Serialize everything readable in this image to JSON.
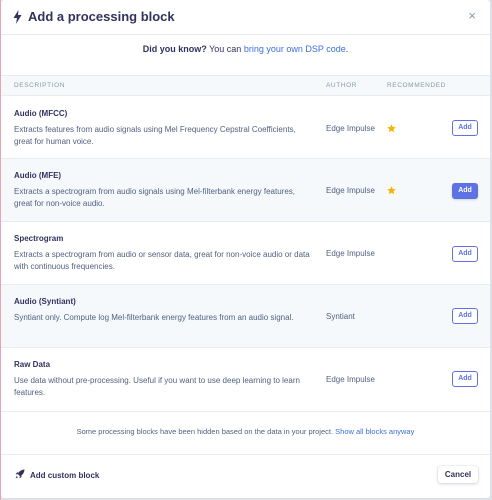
{
  "header": {
    "title": "Add a processing block",
    "close_glyph": "×",
    "icons": [
      "bolt-icon",
      "close-icon"
    ]
  },
  "tip": {
    "lead": "Did you know?",
    "text": " You can ",
    "link": "bring your own DSP code",
    "trail": "."
  },
  "table": {
    "columns": [
      "DESCRIPTION",
      "AUTHOR",
      "RECOMMENDED"
    ],
    "rows": [
      {
        "name": "Audio (MFCC)",
        "description": "Extracts features from audio signals using Mel Frequency Cepstral Coefficients, great for human voice.",
        "author": "Edge Impulse",
        "recommended": true,
        "button": "Add"
      },
      {
        "name": "Audio (MFE)",
        "description": "Extracts a spectrogram from audio signals using Mel-filterbank energy features, great for non-voice audio.",
        "author": "Edge Impulse",
        "recommended": true,
        "button": "Add"
      },
      {
        "name": "Spectrogram",
        "description": "Extracts a spectrogram from audio or sensor data, great for non-voice audio or data with continuous frequencies.",
        "author": "Edge Impulse",
        "recommended": false,
        "button": "Add"
      },
      {
        "name": "Audio (Syntiant)",
        "description": "Syntiant only. Compute log Mel-filterbank energy features from an audio signal.",
        "author": "Syntiant",
        "recommended": false,
        "button": "Add"
      },
      {
        "name": "Raw Data",
        "description": "Use data without pre-processing. Useful if you want to use deep learning to learn features.",
        "author": "Edge Impulse",
        "recommended": false,
        "button": "Add"
      }
    ]
  },
  "hidden_note": {
    "text": "Some processing blocks have been hidden based on the data in your project. ",
    "link": "Show all blocks anyway"
  },
  "footer": {
    "custom_block_label": "Add custom block",
    "cancel_label": "Cancel"
  },
  "colors": {
    "accent": "#5e72e4",
    "link": "#3d6fd8",
    "star": "#f5b400",
    "text": "#32325d"
  }
}
